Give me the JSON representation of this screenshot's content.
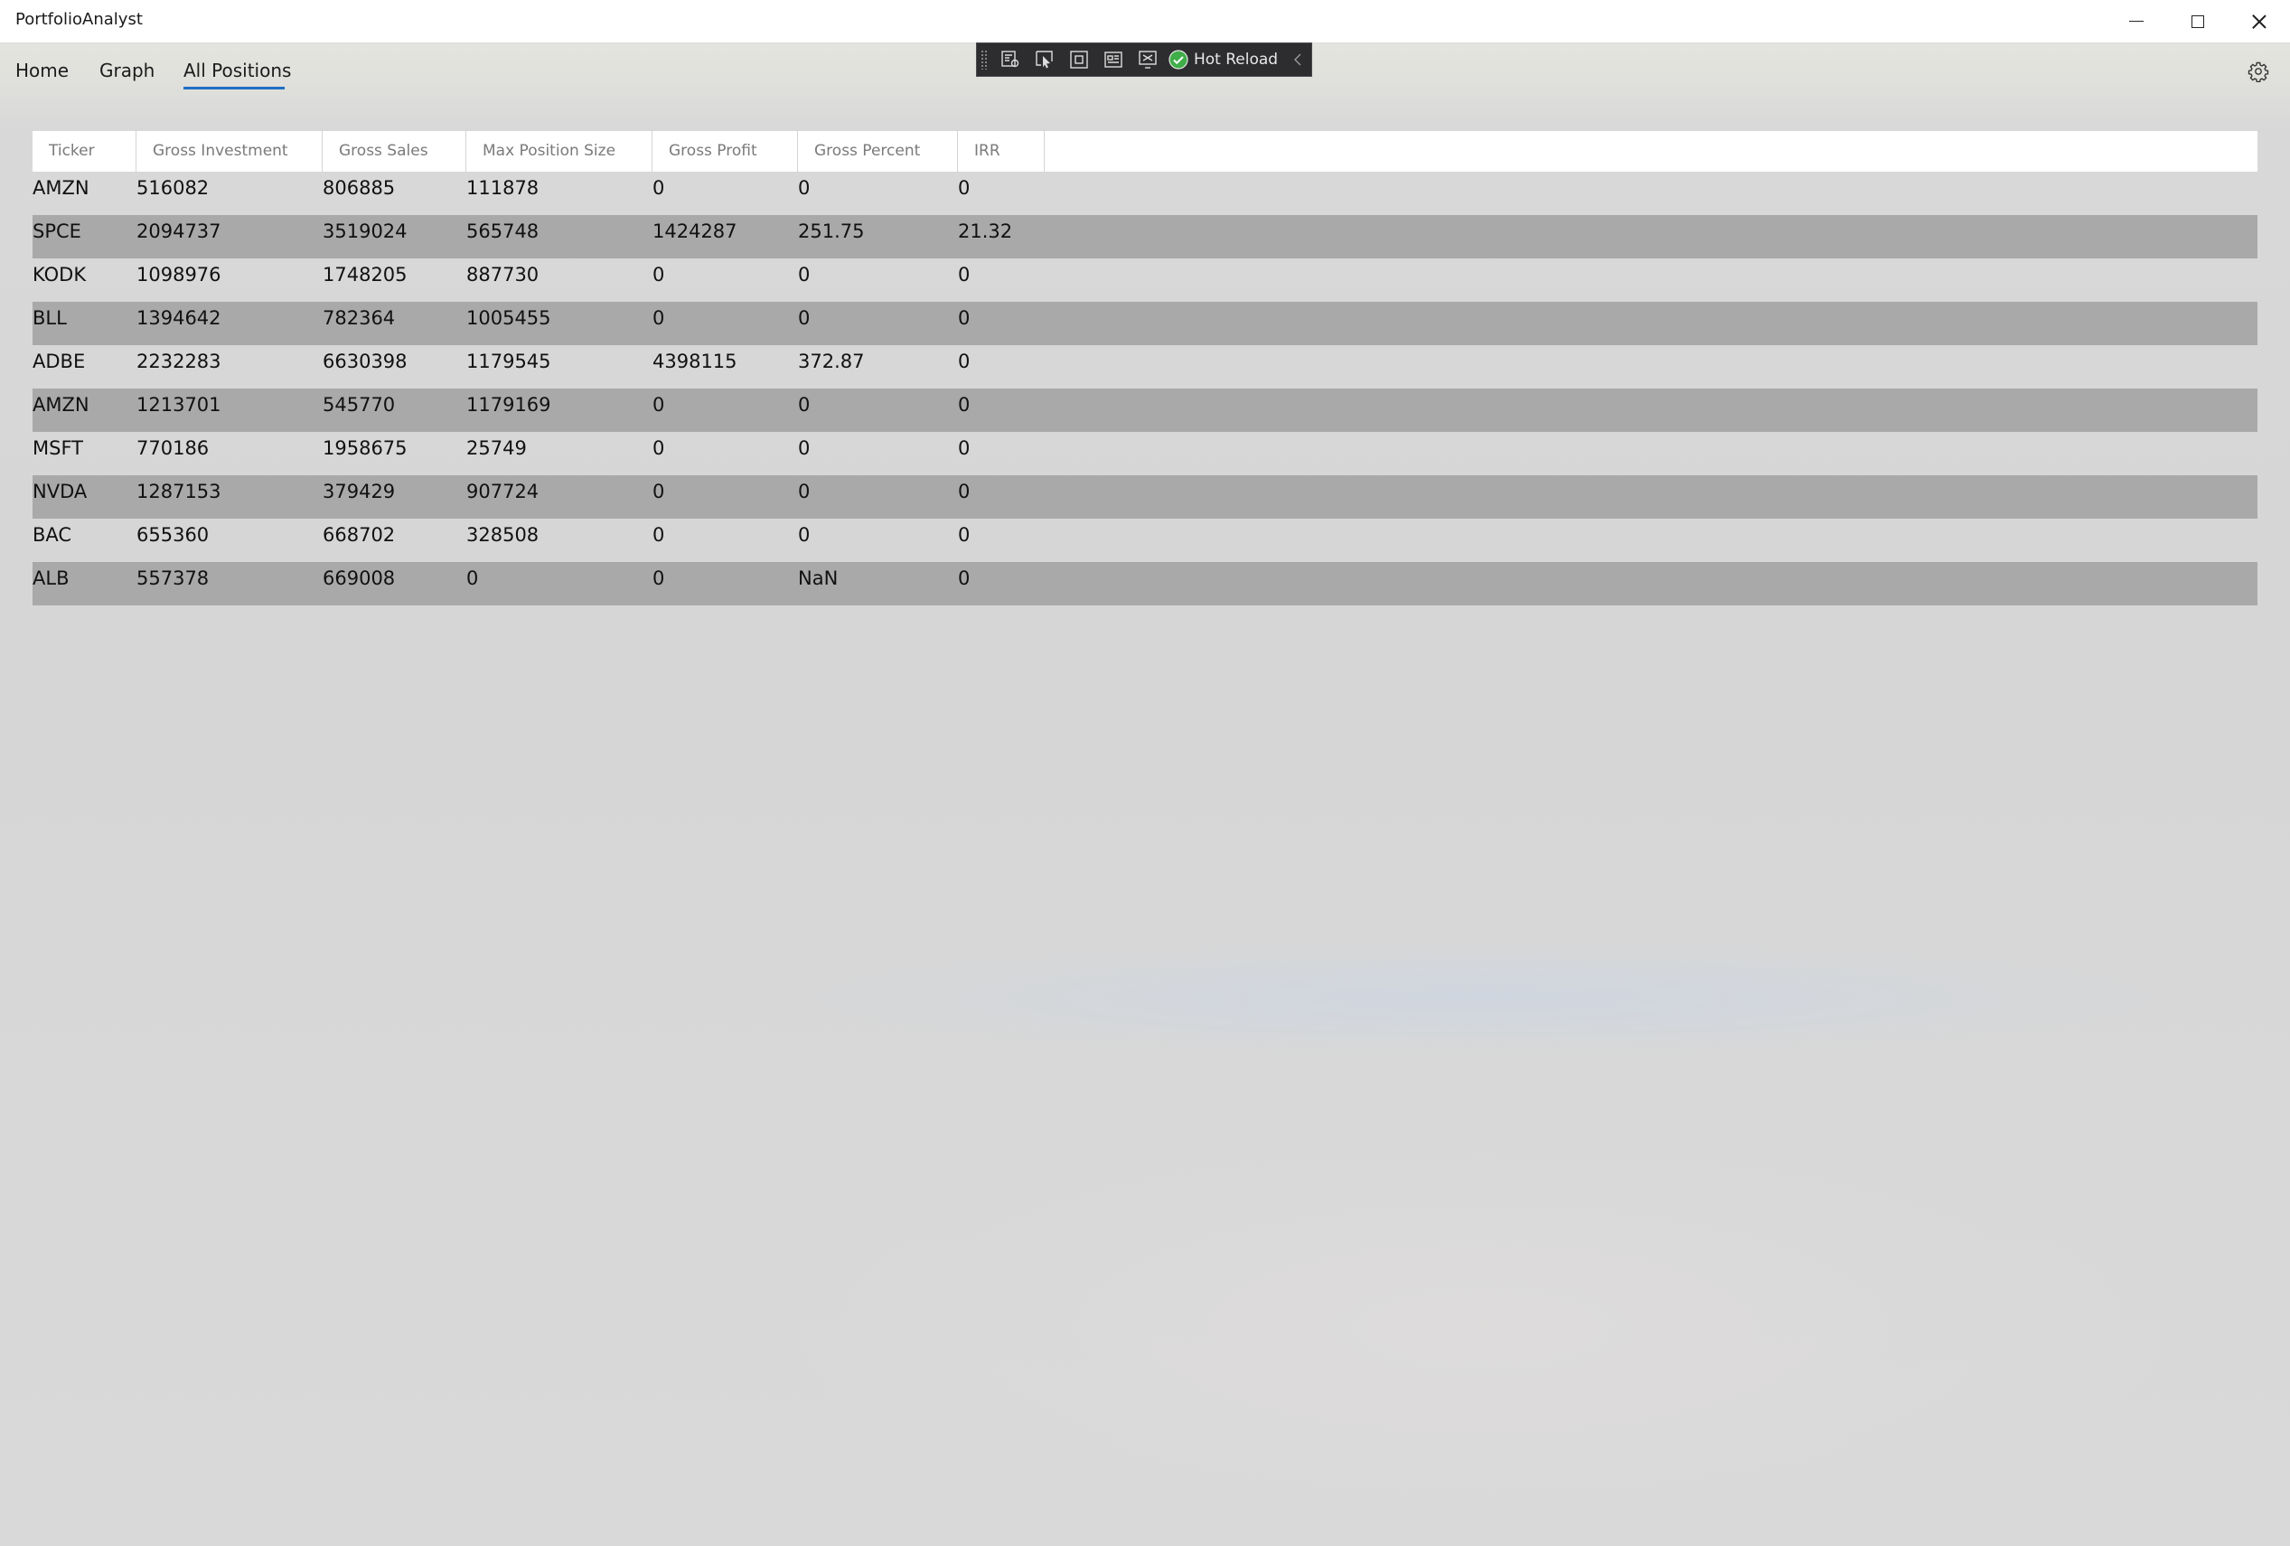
{
  "window": {
    "title": "PortfolioAnalyst",
    "controls": {
      "minimize": "minimize-icon",
      "maximize": "maximize-icon",
      "close": "close-icon"
    }
  },
  "debug_toolbar": {
    "hot_reload_label": "Hot Reload",
    "icons": [
      "live-visual-tree-icon",
      "select-element-icon",
      "display-layout-adorners-icon",
      "track-focus-icon",
      "binding-failures-icon"
    ],
    "status_color": "#3fae49"
  },
  "nav": {
    "items": [
      {
        "label": "Home"
      },
      {
        "label": "Graph"
      },
      {
        "label": "All Positions"
      }
    ],
    "selected": "All Positions",
    "accent": "#1f6fc5",
    "settings_icon": "gear-icon"
  },
  "grid": {
    "columns": [
      "Ticker",
      "Gross Investment",
      "Gross Sales",
      "Max Position Size",
      "Gross Profit",
      "Gross Percent",
      "IRR"
    ],
    "rows": [
      [
        "AMZN",
        "516082",
        "806885",
        "111878",
        "0",
        "0",
        "0"
      ],
      [
        "SPCE",
        "2094737",
        "3519024",
        "565748",
        "1424287",
        "251.75",
        "21.32"
      ],
      [
        "KODK",
        "1098976",
        "1748205",
        "887730",
        "0",
        "0",
        "0"
      ],
      [
        "BLL",
        "1394642",
        "782364",
        "1005455",
        "0",
        "0",
        "0"
      ],
      [
        "ADBE",
        "2232283",
        "6630398",
        "1179545",
        "4398115",
        "372.87",
        "0"
      ],
      [
        "AMZN",
        "1213701",
        "545770",
        "1179169",
        "0",
        "0",
        "0"
      ],
      [
        "MSFT",
        "770186",
        "1958675",
        "25749",
        "0",
        "0",
        "0"
      ],
      [
        "NVDA",
        "1287153",
        "379429",
        "907724",
        "0",
        "0",
        "0"
      ],
      [
        "BAC",
        "655360",
        "668702",
        "328508",
        "0",
        "0",
        "0"
      ],
      [
        "ALB",
        "557378",
        "669008",
        "0",
        "0",
        "NaN",
        "0"
      ]
    ],
    "alt_row_color": "#a9a9a9"
  }
}
